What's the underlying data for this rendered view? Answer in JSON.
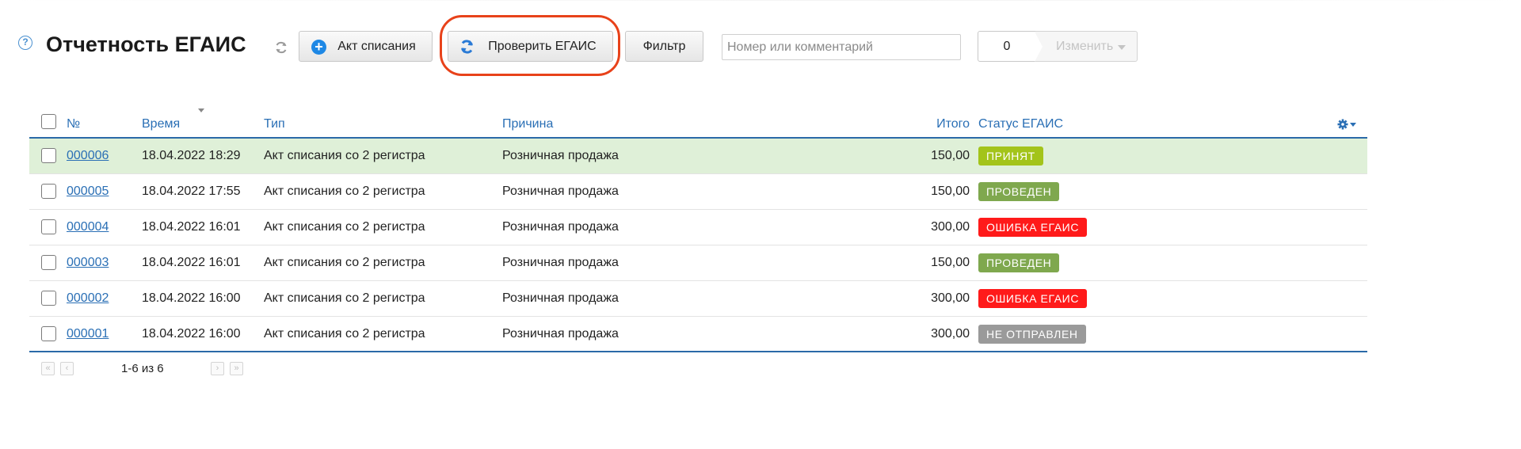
{
  "header": {
    "title": "Отчетность ЕГАИС",
    "help_glyph": "?"
  },
  "toolbar": {
    "act_label": "Акт списания",
    "check_label": "Проверить ЕГАИС",
    "filter_label": "Фильтр",
    "search_placeholder": "Номер или комментарий",
    "search_value": "",
    "selected_count": "0",
    "change_label": "Изменить"
  },
  "table": {
    "columns": {
      "number": "№",
      "time": "Время",
      "type": "Тип",
      "reason": "Причина",
      "total": "Итого",
      "status": "Статус ЕГАИС"
    },
    "rows": [
      {
        "number": "000006",
        "time": "18.04.2022 18:29",
        "type": "Акт списания со 2 регистра",
        "reason": "Розничная продажа",
        "total": "150,00",
        "status": "ПРИНЯТ",
        "selected": true
      },
      {
        "number": "000005",
        "time": "18.04.2022 17:55",
        "type": "Акт списания со 2 регистра",
        "reason": "Розничная продажа",
        "total": "150,00",
        "status": "ПРОВЕДЕН",
        "selected": false
      },
      {
        "number": "000004",
        "time": "18.04.2022 16:01",
        "type": "Акт списания со 2 регистра",
        "reason": "Розничная продажа",
        "total": "300,00",
        "status": "ОШИБКА ЕГАИС",
        "selected": false
      },
      {
        "number": "000003",
        "time": "18.04.2022 16:01",
        "type": "Акт списания со 2 регистра",
        "reason": "Розничная продажа",
        "total": "150,00",
        "status": "ПРОВЕДЕН",
        "selected": false
      },
      {
        "number": "000002",
        "time": "18.04.2022 16:00",
        "type": "Акт списания со 2 регистра",
        "reason": "Розничная продажа",
        "total": "300,00",
        "status": "ОШИБКА ЕГАИС",
        "selected": false
      },
      {
        "number": "000001",
        "time": "18.04.2022 16:00",
        "type": "Акт списания со 2 регистра",
        "reason": "Розничная продажа",
        "total": "300,00",
        "status": "НЕ ОТПРАВЛЕН",
        "selected": false
      }
    ]
  },
  "status_colors": {
    "ПРИНЯТ": "#a3c41a",
    "ПРОВЕДЕН": "#7fa84e",
    "ОШИБКА ЕГАИС": "#ff1a1a",
    "НЕ ОТПРАВЛЕН": "#9a9a9a"
  },
  "colors": {
    "accent": "#2a6fb5",
    "highlight_ring": "#e8421a",
    "selected_row": "#dff0d8"
  },
  "pager": {
    "first": "«",
    "prev": "‹",
    "range_text": "1-6 из 6",
    "next": "›",
    "last": "»"
  }
}
